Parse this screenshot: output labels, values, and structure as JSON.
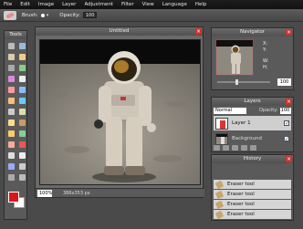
{
  "menu": [
    "File",
    "Edit",
    "Image",
    "Layer",
    "Adjustment",
    "Filter",
    "View",
    "Language",
    "Help"
  ],
  "tool_options": {
    "brush_label": "Brush:",
    "opacity_label": "Opacity:",
    "opacity_value": "100"
  },
  "tools": {
    "title": "Tools",
    "buttons": [
      "move",
      "marquee",
      "lasso",
      "wand",
      "crop",
      "slice",
      "brush",
      "pencil",
      "eraser",
      "bucket",
      "gradient",
      "blur",
      "sharpen",
      "smudge",
      "dodge",
      "burn",
      "sponge",
      "stamp",
      "heal",
      "redeye",
      "eyedropper",
      "text",
      "shape",
      "hand",
      "zoom",
      "extra"
    ],
    "colors": {
      "foreground": "#d9161a",
      "background": "#ffffff"
    }
  },
  "document": {
    "title": "Untitled",
    "zoom": "100%",
    "size_readout": "386x353 px"
  },
  "navigator": {
    "title": "Navigator",
    "x_label": "X:",
    "y_label": "Y:",
    "w_label": "W:",
    "h_label": "H:",
    "zoom": "100"
  },
  "layers": {
    "title": "Layers",
    "blend_mode": "Normal",
    "opacity_label": "Opacity:",
    "opacity_value": "100",
    "items": [
      {
        "name": "Layer 1",
        "selected": true
      },
      {
        "name": "Background",
        "selected": false
      }
    ]
  },
  "history": {
    "title": "History",
    "items": [
      "Eraser tool",
      "Eraser tool",
      "Eraser tool",
      "Eraser tool"
    ]
  }
}
